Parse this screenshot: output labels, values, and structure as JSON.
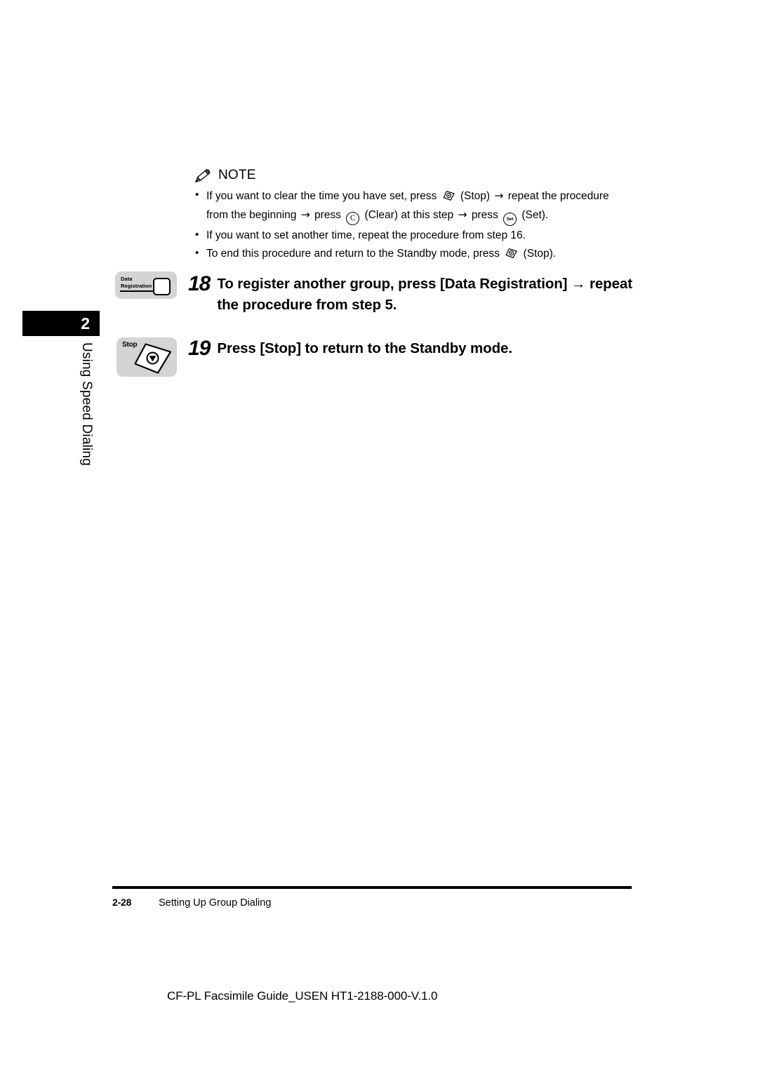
{
  "sidebar": {
    "chapter_number": "2",
    "chapter_title": "Using Speed Dialing"
  },
  "note": {
    "icon": "pencil-icon",
    "title": "NOTE",
    "items": [
      {
        "segments": [
          {
            "type": "text",
            "value": "If you want to clear the time you have set, press "
          },
          {
            "type": "icon",
            "value": "stop-key-icon"
          },
          {
            "type": "text",
            "value": " (Stop) "
          },
          {
            "type": "arrow",
            "value": "→"
          },
          {
            "type": "text",
            "value": " repeat the procedure from the beginning "
          },
          {
            "type": "arrow",
            "value": "→"
          },
          {
            "type": "text",
            "value": " press "
          },
          {
            "type": "icon",
            "value": "clear-key-icon"
          },
          {
            "type": "text",
            "value": " (Clear) at this step "
          },
          {
            "type": "arrow",
            "value": "→"
          },
          {
            "type": "text",
            "value": " press "
          },
          {
            "type": "icon",
            "value": "set-key-icon"
          },
          {
            "type": "text",
            "value": " (Set)."
          }
        ],
        "line1_a": "If you want to clear the time you have set, press",
        "line1_b": "(Stop)",
        "line1_c": "repeat the procedure",
        "line2_a": "from the beginning",
        "line2_b": "press",
        "line2_c": "(Clear) at this step",
        "line2_d": "press",
        "line2_e": "(Set)."
      },
      {
        "text": "If you want to set another time, repeat the procedure from step 16."
      },
      {
        "text_a": "To end this procedure and return to the Standby mode, press",
        "text_b": "(Stop)."
      }
    ],
    "key_labels": {
      "clear": "C",
      "set": "Set"
    }
  },
  "steps": [
    {
      "number": "18",
      "line1": "To register another group, press [Data Registration] → repeat",
      "line2": "the procedure from step 5.",
      "button": {
        "name": "data-registration-button",
        "label_line1": "Data",
        "label_line2": "Registration"
      }
    },
    {
      "number": "19",
      "line1": "Press [Stop] to return to the Standby mode.",
      "button": {
        "name": "stop-button",
        "label": "Stop"
      }
    }
  ],
  "footer": {
    "page_number": "2-28",
    "section_title": "Setting Up Group Dialing"
  },
  "document_code": "CF-PL Facsimile Guide_USEN HT1-2188-000-V.1.0",
  "colors": {
    "tab_background": "#000000",
    "tab_text": "#ffffff",
    "button_gray": "#d4d4d4",
    "page_background": "#ffffff",
    "text": "#000000"
  }
}
